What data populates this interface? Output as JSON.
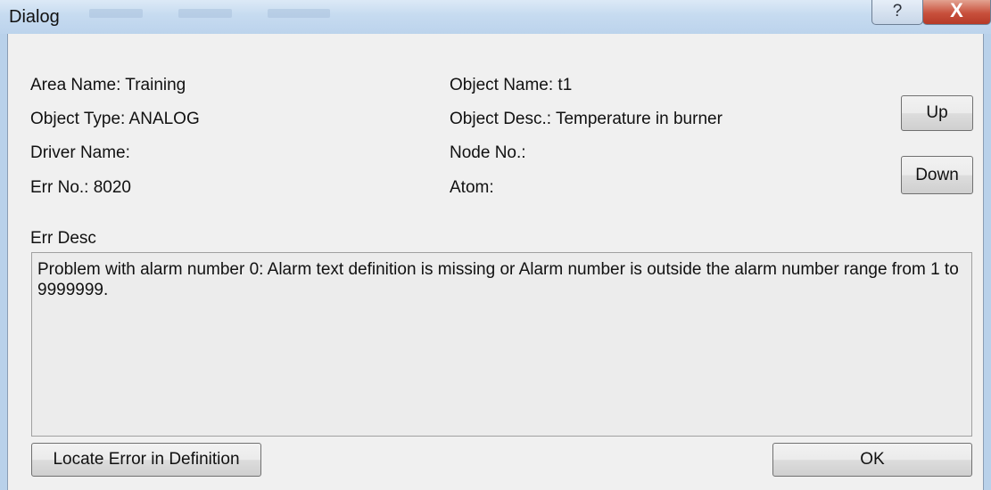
{
  "window": {
    "title": "Dialog",
    "help_glyph": "?",
    "close_glyph": "X"
  },
  "fields": {
    "area_name": "Area Name: Training",
    "object_type": "Object Type: ANALOG",
    "driver_name": "Driver Name:",
    "err_no": "Err No.: 8020",
    "object_name": "Object Name: t1",
    "object_desc": "Object Desc.: Temperature in burner",
    "node_no": "Node No.:",
    "atom": "Atom:"
  },
  "buttons": {
    "up": "Up",
    "down": "Down",
    "locate": "Locate Error in Definition",
    "ok": "OK"
  },
  "err_desc": {
    "label": "Err Desc",
    "text": "Problem with alarm number 0: Alarm text definition is missing or Alarm number is outside the alarm number range from 1 to 9999999."
  },
  "icons": [
    "help-icon",
    "close-icon"
  ]
}
